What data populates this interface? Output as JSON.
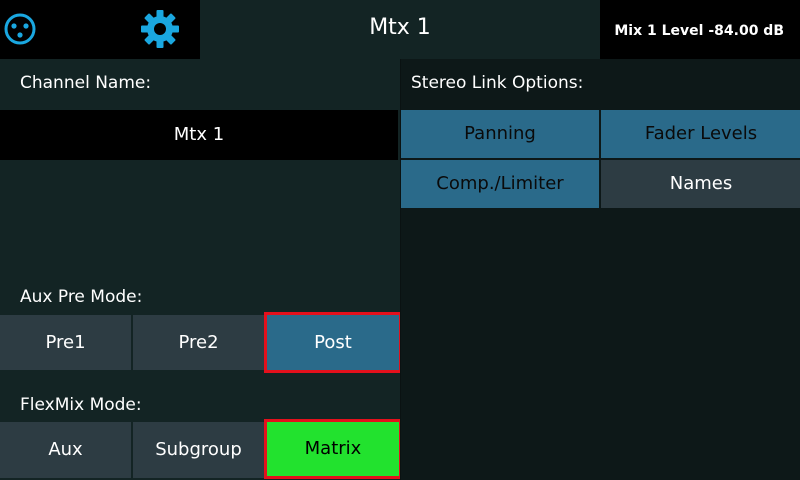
{
  "header": {
    "title": "Mtx 1",
    "level_readout": "Mix 1 Level -84.00 dB",
    "icons": [
      "xlr-connector-icon",
      "gear-icon"
    ],
    "accent_color": "#1aa7e0"
  },
  "left": {
    "channel_name_label": "Channel Name:",
    "channel_name_value": "Mtx 1",
    "aux_pre_mode": {
      "label": "Aux Pre Mode:",
      "options": [
        "Pre1",
        "Pre2",
        "Post"
      ],
      "selected": "Post"
    },
    "flexmix_mode": {
      "label": "FlexMix Mode:",
      "options": [
        "Aux",
        "Subgroup",
        "Matrix"
      ],
      "selected": "Matrix"
    }
  },
  "right": {
    "stereo_link_label": "Stereo Link Options:",
    "options": [
      {
        "label": "Panning",
        "active": true
      },
      {
        "label": "Fader Levels",
        "active": true
      },
      {
        "label": "Comp./Limiter",
        "active": true
      },
      {
        "label": "Names",
        "active": false
      }
    ]
  },
  "colors": {
    "selected_border": "#e4101c",
    "active_blue": "#2a6a8a",
    "matrix_green": "#22e22e",
    "inactive": "#2d3c43"
  }
}
